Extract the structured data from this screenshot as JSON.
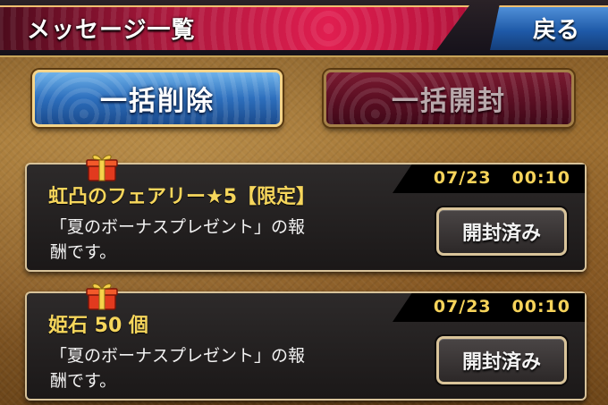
{
  "header": {
    "title": "メッセージ一覧",
    "back_label": "戻る"
  },
  "bulk_actions": {
    "delete_label": "一括削除",
    "open_label": "一括開封"
  },
  "messages": [
    {
      "title": "虹凸のフェアリー★5【限定】",
      "date": "07/23",
      "time": "00:10",
      "body_line1": "「夏のボーナスプレゼント」の報",
      "body_line2": "酬です。",
      "status_label": "開封済み",
      "icon": "gift-icon"
    },
    {
      "title": "姫石 50 個",
      "date": "07/23",
      "time": "00:10",
      "body_line1": "「夏のボーナスプレゼント」の報",
      "body_line2": "酬です。",
      "status_label": "開封済み",
      "icon": "gift-icon"
    }
  ],
  "colors": {
    "title_banner": "#e01e50",
    "back_button": "#1f5aa8",
    "message_title": "#f6d65c",
    "date_text": "#f6d35a",
    "card_border": "#d8c39a"
  }
}
